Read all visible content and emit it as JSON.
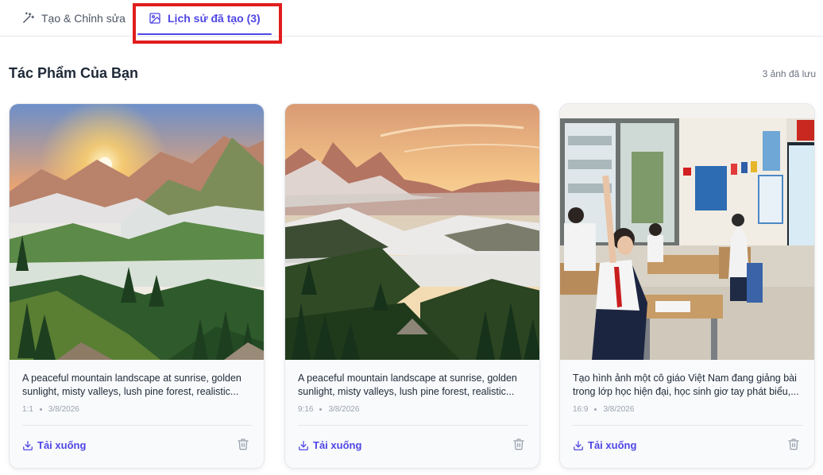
{
  "tabs": {
    "create_label": "Tạo & Chỉnh sửa",
    "history_label": "Lịch sử đã tạo (3)"
  },
  "section": {
    "title": "Tác Phẩm Của Bạn",
    "count": "3 ảnh đã lưu"
  },
  "cards": [
    {
      "prompt": "A peaceful mountain landscape at sunrise, golden sunlight, misty valleys, lush pine forest, realistic...",
      "ratio": "1:1",
      "date": "3/8/2026",
      "download_label": "Tải xuống",
      "image": "mountain-sunrise"
    },
    {
      "prompt": "A peaceful mountain landscape at sunrise, golden sunlight, misty valleys, lush pine forest, realistic...",
      "ratio": "9:16",
      "date": "3/8/2026",
      "download_label": "Tải xuống",
      "image": "mountain-misty-valley"
    },
    {
      "prompt": "Tạo hình ảnh một cô giáo Việt Nam đang giảng bài trong lớp học hiện đại, học sinh giơ tay phát biểu,...",
      "ratio": "16:9",
      "date": "3/8/2026",
      "download_label": "Tải xuống",
      "image": "classroom"
    }
  ],
  "colors": {
    "accent": "#4f46e5",
    "highlight": "#e11d1d"
  }
}
